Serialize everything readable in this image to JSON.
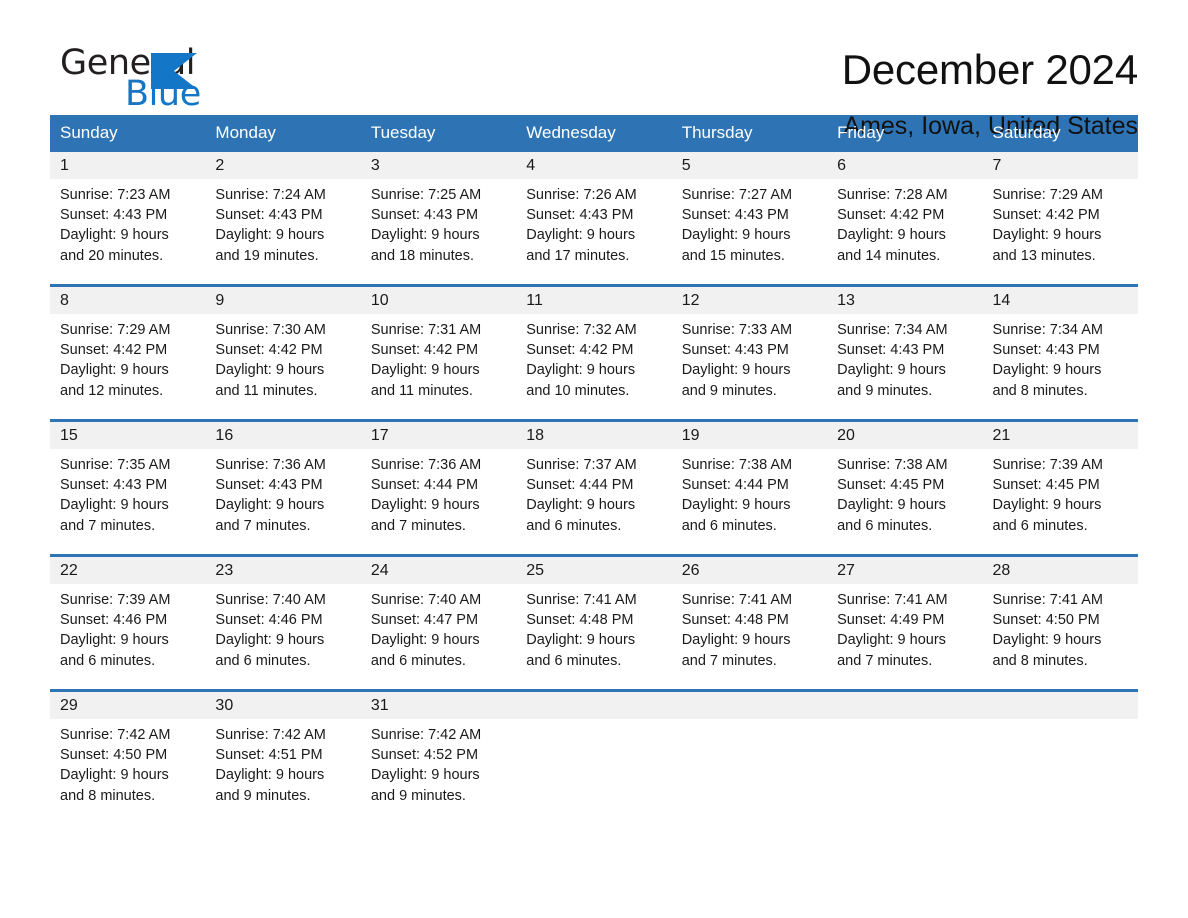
{
  "brand": {
    "name_part1": "General",
    "name_part2": "Blue",
    "logo_color": "#1476c6",
    "triangle_icon": "triangle-icon"
  },
  "header": {
    "title": "December 2024",
    "subtitle": "Ames, Iowa, United States"
  },
  "theme": {
    "header_blue": "#2e74b5",
    "daynum_band": "#f1f1f1",
    "text": "#1a1a1a"
  },
  "calendar": {
    "weekday_headers": [
      "Sunday",
      "Monday",
      "Tuesday",
      "Wednesday",
      "Thursday",
      "Friday",
      "Saturday"
    ],
    "weeks": [
      [
        {
          "day": "1",
          "sunrise": "Sunrise: 7:23 AM",
          "sunset": "Sunset: 4:43 PM",
          "daylight_line1": "Daylight: 9 hours",
          "daylight_line2": "and 20 minutes."
        },
        {
          "day": "2",
          "sunrise": "Sunrise: 7:24 AM",
          "sunset": "Sunset: 4:43 PM",
          "daylight_line1": "Daylight: 9 hours",
          "daylight_line2": "and 19 minutes."
        },
        {
          "day": "3",
          "sunrise": "Sunrise: 7:25 AM",
          "sunset": "Sunset: 4:43 PM",
          "daylight_line1": "Daylight: 9 hours",
          "daylight_line2": "and 18 minutes."
        },
        {
          "day": "4",
          "sunrise": "Sunrise: 7:26 AM",
          "sunset": "Sunset: 4:43 PM",
          "daylight_line1": "Daylight: 9 hours",
          "daylight_line2": "and 17 minutes."
        },
        {
          "day": "5",
          "sunrise": "Sunrise: 7:27 AM",
          "sunset": "Sunset: 4:43 PM",
          "daylight_line1": "Daylight: 9 hours",
          "daylight_line2": "and 15 minutes."
        },
        {
          "day": "6",
          "sunrise": "Sunrise: 7:28 AM",
          "sunset": "Sunset: 4:42 PM",
          "daylight_line1": "Daylight: 9 hours",
          "daylight_line2": "and 14 minutes."
        },
        {
          "day": "7",
          "sunrise": "Sunrise: 7:29 AM",
          "sunset": "Sunset: 4:42 PM",
          "daylight_line1": "Daylight: 9 hours",
          "daylight_line2": "and 13 minutes."
        }
      ],
      [
        {
          "day": "8",
          "sunrise": "Sunrise: 7:29 AM",
          "sunset": "Sunset: 4:42 PM",
          "daylight_line1": "Daylight: 9 hours",
          "daylight_line2": "and 12 minutes."
        },
        {
          "day": "9",
          "sunrise": "Sunrise: 7:30 AM",
          "sunset": "Sunset: 4:42 PM",
          "daylight_line1": "Daylight: 9 hours",
          "daylight_line2": "and 11 minutes."
        },
        {
          "day": "10",
          "sunrise": "Sunrise: 7:31 AM",
          "sunset": "Sunset: 4:42 PM",
          "daylight_line1": "Daylight: 9 hours",
          "daylight_line2": "and 11 minutes."
        },
        {
          "day": "11",
          "sunrise": "Sunrise: 7:32 AM",
          "sunset": "Sunset: 4:42 PM",
          "daylight_line1": "Daylight: 9 hours",
          "daylight_line2": "and 10 minutes."
        },
        {
          "day": "12",
          "sunrise": "Sunrise: 7:33 AM",
          "sunset": "Sunset: 4:43 PM",
          "daylight_line1": "Daylight: 9 hours",
          "daylight_line2": "and 9 minutes."
        },
        {
          "day": "13",
          "sunrise": "Sunrise: 7:34 AM",
          "sunset": "Sunset: 4:43 PM",
          "daylight_line1": "Daylight: 9 hours",
          "daylight_line2": "and 9 minutes."
        },
        {
          "day": "14",
          "sunrise": "Sunrise: 7:34 AM",
          "sunset": "Sunset: 4:43 PM",
          "daylight_line1": "Daylight: 9 hours",
          "daylight_line2": "and 8 minutes."
        }
      ],
      [
        {
          "day": "15",
          "sunrise": "Sunrise: 7:35 AM",
          "sunset": "Sunset: 4:43 PM",
          "daylight_line1": "Daylight: 9 hours",
          "daylight_line2": "and 7 minutes."
        },
        {
          "day": "16",
          "sunrise": "Sunrise: 7:36 AM",
          "sunset": "Sunset: 4:43 PM",
          "daylight_line1": "Daylight: 9 hours",
          "daylight_line2": "and 7 minutes."
        },
        {
          "day": "17",
          "sunrise": "Sunrise: 7:36 AM",
          "sunset": "Sunset: 4:44 PM",
          "daylight_line1": "Daylight: 9 hours",
          "daylight_line2": "and 7 minutes."
        },
        {
          "day": "18",
          "sunrise": "Sunrise: 7:37 AM",
          "sunset": "Sunset: 4:44 PM",
          "daylight_line1": "Daylight: 9 hours",
          "daylight_line2": "and 6 minutes."
        },
        {
          "day": "19",
          "sunrise": "Sunrise: 7:38 AM",
          "sunset": "Sunset: 4:44 PM",
          "daylight_line1": "Daylight: 9 hours",
          "daylight_line2": "and 6 minutes."
        },
        {
          "day": "20",
          "sunrise": "Sunrise: 7:38 AM",
          "sunset": "Sunset: 4:45 PM",
          "daylight_line1": "Daylight: 9 hours",
          "daylight_line2": "and 6 minutes."
        },
        {
          "day": "21",
          "sunrise": "Sunrise: 7:39 AM",
          "sunset": "Sunset: 4:45 PM",
          "daylight_line1": "Daylight: 9 hours",
          "daylight_line2": "and 6 minutes."
        }
      ],
      [
        {
          "day": "22",
          "sunrise": "Sunrise: 7:39 AM",
          "sunset": "Sunset: 4:46 PM",
          "daylight_line1": "Daylight: 9 hours",
          "daylight_line2": "and 6 minutes."
        },
        {
          "day": "23",
          "sunrise": "Sunrise: 7:40 AM",
          "sunset": "Sunset: 4:46 PM",
          "daylight_line1": "Daylight: 9 hours",
          "daylight_line2": "and 6 minutes."
        },
        {
          "day": "24",
          "sunrise": "Sunrise: 7:40 AM",
          "sunset": "Sunset: 4:47 PM",
          "daylight_line1": "Daylight: 9 hours",
          "daylight_line2": "and 6 minutes."
        },
        {
          "day": "25",
          "sunrise": "Sunrise: 7:41 AM",
          "sunset": "Sunset: 4:48 PM",
          "daylight_line1": "Daylight: 9 hours",
          "daylight_line2": "and 6 minutes."
        },
        {
          "day": "26",
          "sunrise": "Sunrise: 7:41 AM",
          "sunset": "Sunset: 4:48 PM",
          "daylight_line1": "Daylight: 9 hours",
          "daylight_line2": "and 7 minutes."
        },
        {
          "day": "27",
          "sunrise": "Sunrise: 7:41 AM",
          "sunset": "Sunset: 4:49 PM",
          "daylight_line1": "Daylight: 9 hours",
          "daylight_line2": "and 7 minutes."
        },
        {
          "day": "28",
          "sunrise": "Sunrise: 7:41 AM",
          "sunset": "Sunset: 4:50 PM",
          "daylight_line1": "Daylight: 9 hours",
          "daylight_line2": "and 8 minutes."
        }
      ],
      [
        {
          "day": "29",
          "sunrise": "Sunrise: 7:42 AM",
          "sunset": "Sunset: 4:50 PM",
          "daylight_line1": "Daylight: 9 hours",
          "daylight_line2": "and 8 minutes."
        },
        {
          "day": "30",
          "sunrise": "Sunrise: 7:42 AM",
          "sunset": "Sunset: 4:51 PM",
          "daylight_line1": "Daylight: 9 hours",
          "daylight_line2": "and 9 minutes."
        },
        {
          "day": "31",
          "sunrise": "Sunrise: 7:42 AM",
          "sunset": "Sunset: 4:52 PM",
          "daylight_line1": "Daylight: 9 hours",
          "daylight_line2": "and 9 minutes."
        },
        {
          "day": "",
          "sunrise": "",
          "sunset": "",
          "daylight_line1": "",
          "daylight_line2": ""
        },
        {
          "day": "",
          "sunrise": "",
          "sunset": "",
          "daylight_line1": "",
          "daylight_line2": ""
        },
        {
          "day": "",
          "sunrise": "",
          "sunset": "",
          "daylight_line1": "",
          "daylight_line2": ""
        },
        {
          "day": "",
          "sunrise": "",
          "sunset": "",
          "daylight_line1": "",
          "daylight_line2": ""
        }
      ]
    ]
  }
}
